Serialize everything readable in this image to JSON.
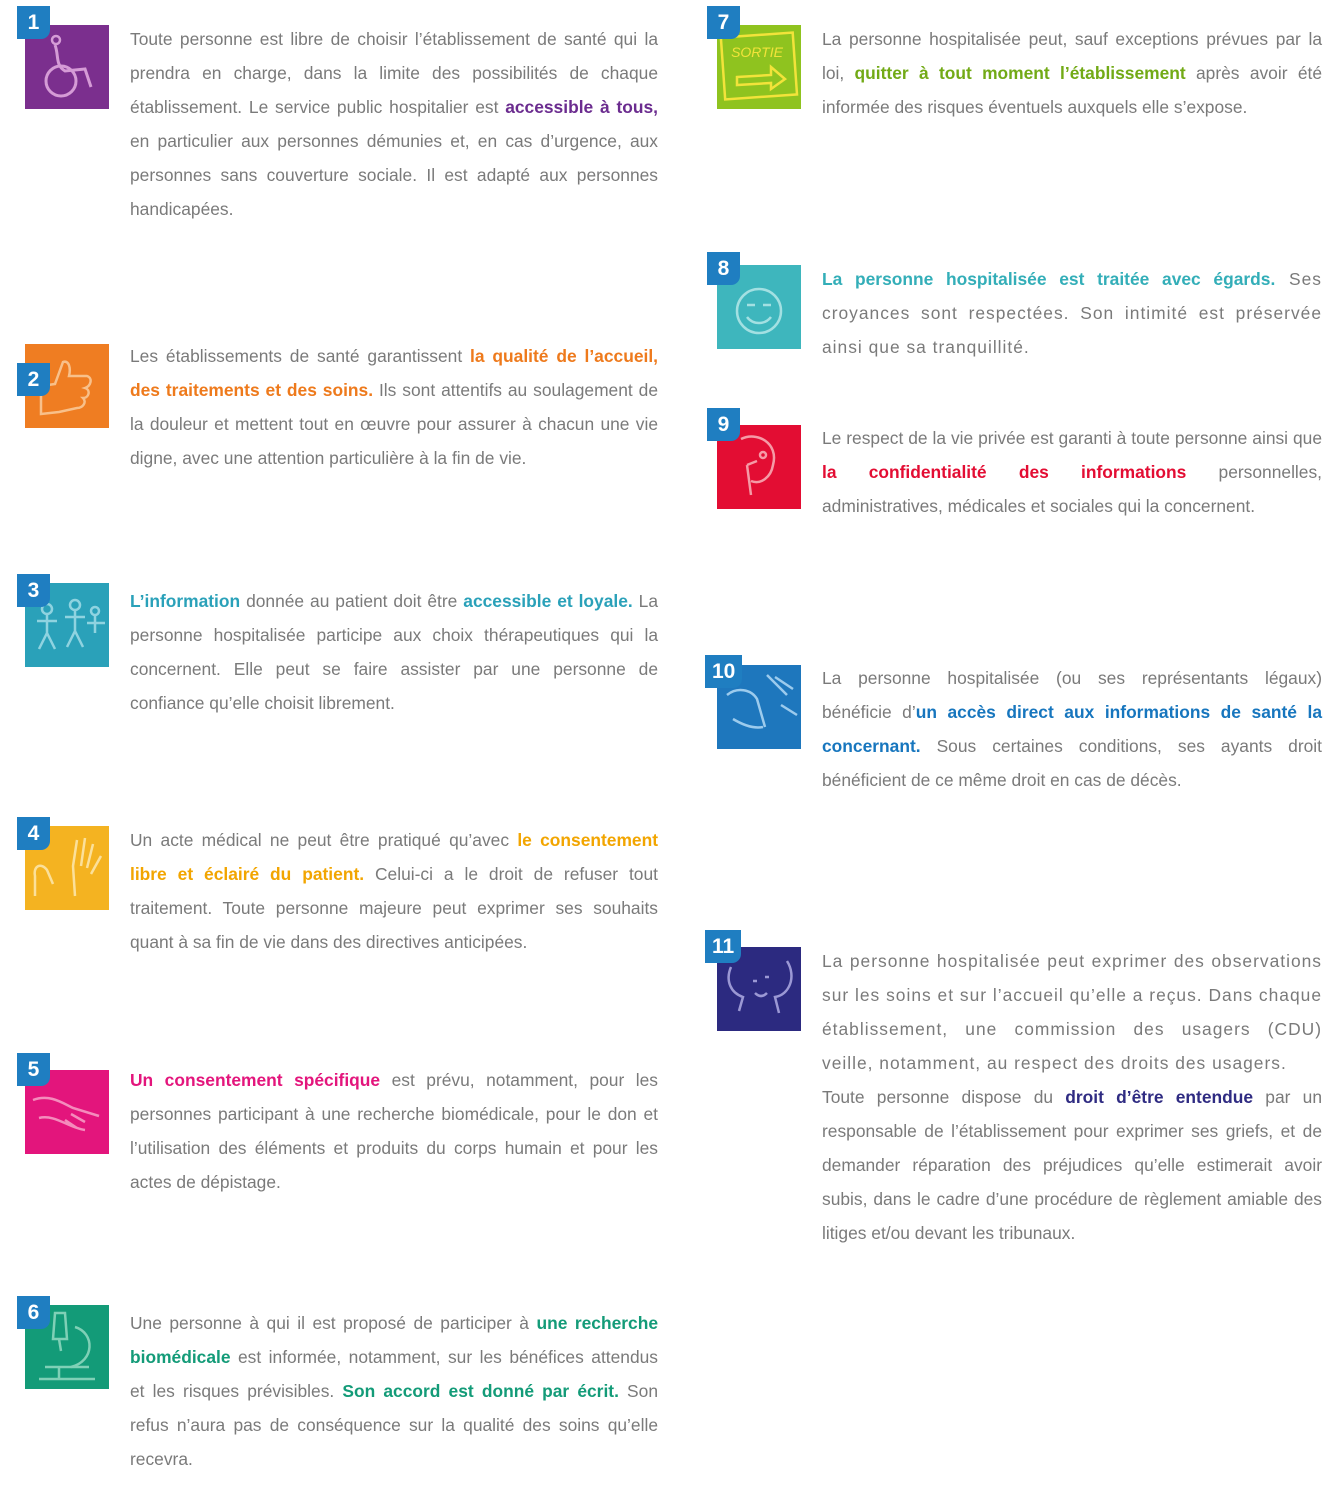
{
  "colors": {
    "badge": "#1f7ec1",
    "body_text": "#7a7a7a",
    "art1": "#7b2f8e",
    "art2": "#ef7d22",
    "art3": "#2aa1b9",
    "art4": "#f4b321",
    "art5": "#e3157c",
    "art6": "#139b78",
    "art7": "#8fc31f",
    "art8": "#3eb6bd",
    "art9": "#e30d33",
    "art10": "#1e77bd",
    "art11": "#2c2a80"
  },
  "articles": [
    {
      "number": "1",
      "icon": "wheelchair-icon",
      "p1": "Toute personne est libre de choisir l’établissement de santé qui la prendra en charge, dans la limite des possibilités de chaque établissement. Le service public hospitalier est ",
      "h1": "accessible à tous,",
      "p2": " en particulier aux personnes démunies et, en cas d’urgence, aux personnes sans couverture sociale. Il est adapté aux personnes handicapées."
    },
    {
      "number": "2",
      "icon": "thumbs-up-icon",
      "p1": "Les établissements de santé garantissent ",
      "h1": "la qualité de l’accueil, des traitements et des soins.",
      "p2": " Ils sont attentifs au soulagement de la douleur et mettent tout en œuvre pour assurer à chacun une vie digne, avec une attention particulière à la fin de vie."
    },
    {
      "number": "3",
      "icon": "people-icon",
      "h1": "L’information",
      "p1": " donnée au patient doit être ",
      "h2": "accessible et loyale.",
      "p2": " La personne hospitalisée participe aux choix thérapeutiques qui la concernent. Elle peut se faire assister par une personne de confiance qu’elle choisit librement."
    },
    {
      "number": "4",
      "icon": "hands-icon",
      "p1": "Un acte médical ne peut être pratiqué qu’avec ",
      "h1": "le consentement libre et éclairé du patient.",
      "p2": " Celui-ci a le droit de refuser tout traitement. Toute personne majeure peut exprimer ses souhaits quant à sa fin de vie dans des directives anticipées."
    },
    {
      "number": "5",
      "icon": "handshake-icon",
      "h1": "Un consentement spécifique",
      "p1": " est prévu, notamment, pour les personnes participant à une recherche biomédicale, pour le don et l’utilisation des éléments et produits du corps humain et pour les actes de dépistage."
    },
    {
      "number": "6",
      "icon": "microscope-icon",
      "p1": "Une personne à qui il est proposé de participer à ",
      "h1": "une recherche biomédicale",
      "p2": " est informée, notamment, sur les bénéfices attendus et les risques prévisibles. ",
      "h2": "Son accord est donné par écrit.",
      "p3": " Son refus n’aura pas de conséquence sur la qualité des soins qu’elle recevra."
    },
    {
      "number": "7",
      "icon": "exit-sign-icon",
      "sign_text": "SORTIE",
      "p1": "La personne hospitalisée peut, sauf exceptions prévues par la loi, ",
      "h1": "quitter à tout moment l’établissement",
      "p2": " après avoir été informée des risques éventuels auxquels elle s’expose."
    },
    {
      "number": "8",
      "icon": "smiley-icon",
      "h1": "La personne hospitalisée est traitée avec égards.",
      "p1": " Ses croyances sont respectées. Son intimité est préservée ainsi que sa tranquillité."
    },
    {
      "number": "9",
      "icon": "secret-finger-icon",
      "p1": "Le respect de la vie privée est garanti à toute personne ainsi que ",
      "h1": "la confidentialité des informations",
      "p2": " personnelles, administratives, médicales et sociales qui la concernent."
    },
    {
      "number": "10",
      "icon": "document-access-icon",
      "p1": "La personne hospitalisée (ou ses représentants légaux) bénéficie d’",
      "h1": "un accès direct aux informations de santé la concernant.",
      "p2": " Sous certaines conditions, ses ayants droit bénéficient de ce même droit en cas de décès."
    },
    {
      "number": "11",
      "icon": "faces-talking-icon",
      "p1": "La personne hospitalisée peut exprimer des observations sur les soins et sur l’accueil qu’elle a reçus. Dans chaque établissement, une commission des usagers (CDU) veille, notamment, au respect des droits des usagers.",
      "p2": "Toute personne dispose du ",
      "h1": "droit d’être entendue",
      "p3": " par un responsable de l’établissement pour exprimer ses griefs, et de demander réparation des préjudices qu’elle estimerait avoir subis, dans le cadre d’une procédure de règlement amiable des litiges et/ou devant les tribunaux."
    }
  ]
}
